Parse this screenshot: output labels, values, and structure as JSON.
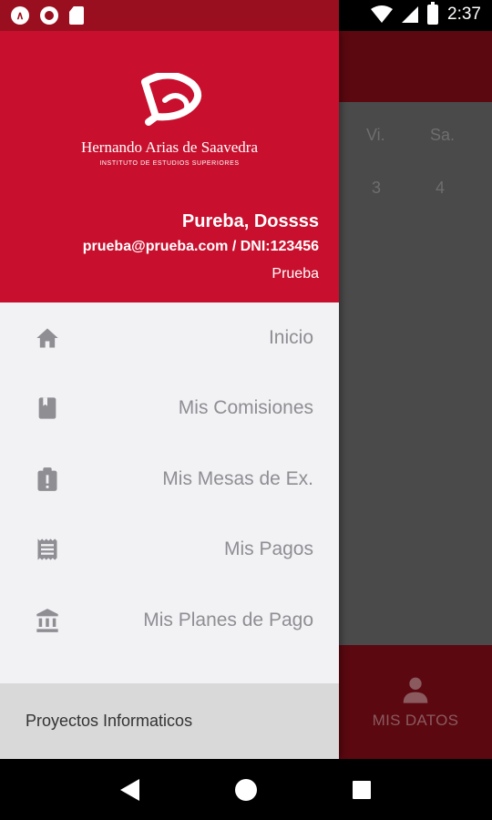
{
  "status_bar": {
    "time": "2:37",
    "left_icons": [
      "app-a-icon",
      "record-icon",
      "sd-card-icon"
    ],
    "right_icons": [
      "wifi-icon",
      "signal-icon",
      "battery-icon"
    ]
  },
  "drawer": {
    "logo": {
      "name": "Hernando Arias de Saavedra",
      "subtitle": "INSTITUTO DE ESTUDIOS SUPERIORES"
    },
    "user": {
      "name": "Pureba, Dossss",
      "email_dni": "prueba@prueba.com / DNI:123456",
      "role": "Prueba"
    },
    "menu": [
      {
        "label": "Inicio",
        "icon": "home-icon"
      },
      {
        "label": "Mis Comisiones",
        "icon": "book-icon"
      },
      {
        "label": "Mis Mesas de Ex.",
        "icon": "clipboard-alert-icon"
      },
      {
        "label": "Mis Pagos",
        "icon": "receipt-icon"
      },
      {
        "label": "Mis Planes de Pago",
        "icon": "bank-icon"
      }
    ],
    "footer": "Proyectos Informaticos"
  },
  "background_app": {
    "days": [
      "Vi.",
      "Sa."
    ],
    "dates": [
      "3",
      "4"
    ],
    "footer_label": "MIS DATOS",
    "footer_icon": "person-icon"
  },
  "colors": {
    "brand_red": "#c8102e",
    "status_dark_red": "#9a0f1f",
    "drawer_bg": "#f2f2f5",
    "icon_gray": "#8e8e93"
  }
}
